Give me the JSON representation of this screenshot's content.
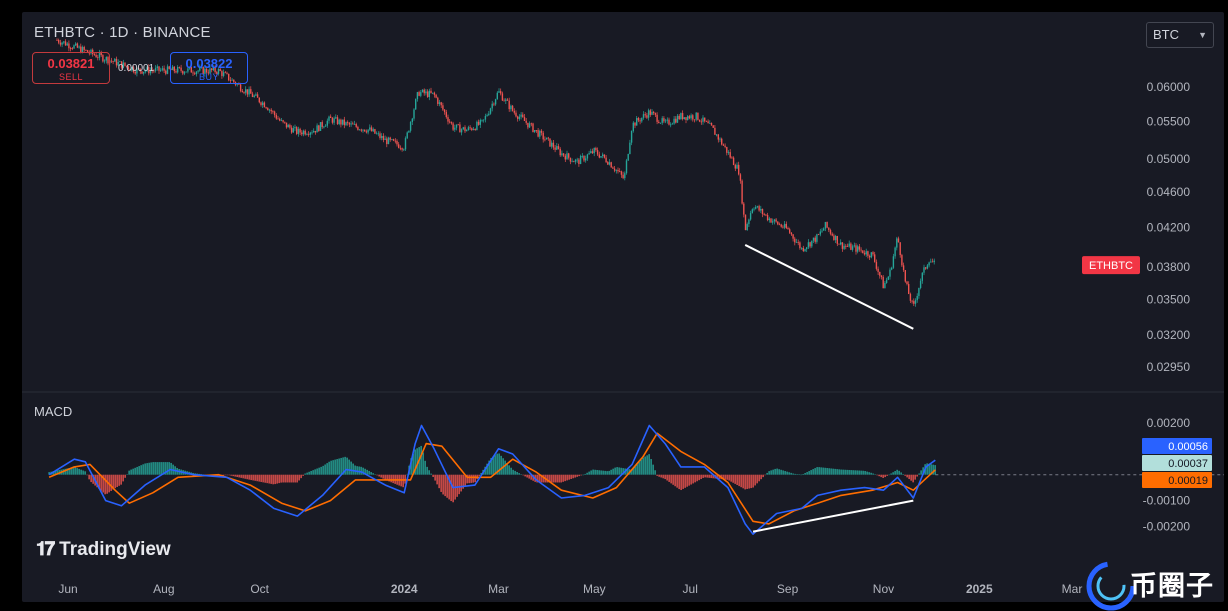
{
  "header": {
    "symbol_line": "ETHBTC · 1D · BINANCE"
  },
  "trade": {
    "sell_price": "0.03821",
    "sell_label": "SELL",
    "spread": "0.00001",
    "buy_price": "0.03822",
    "buy_label": "BUY"
  },
  "currency_select": {
    "value": "BTC"
  },
  "macd": {
    "title": "MACD"
  },
  "branding": {
    "logo_text": "TradingView",
    "watermark_text": "币圈子"
  },
  "colors": {
    "up": "#26a69a",
    "down": "#ef5350",
    "macd_line": "#2962ff",
    "signal_line": "#ff6d00",
    "hist_up": "#26a69a",
    "hist_down": "#ef5350",
    "badge": "#f23645",
    "annotation": "#ffffff"
  },
  "chart_data": [
    {
      "type": "candlestick",
      "symbol": "ETHBTC",
      "interval": "1D",
      "exchange": "BINANCE",
      "price_axis": {
        "ticks": [
          "0.06000",
          "0.05500",
          "0.05000",
          "0.04600",
          "0.04200",
          "0.03800",
          "0.03500",
          "0.03200",
          "0.02950"
        ],
        "scale": "log",
        "range": [
          0.0283,
          0.064
        ]
      },
      "time_axis": {
        "ticks": [
          "Jun",
          "Aug",
          "Oct",
          "2024",
          "Mar",
          "May",
          "Jul",
          "Sep",
          "Nov",
          "2025",
          "Mar"
        ]
      },
      "last_price_label": "ETHBTC",
      "series": [
        {
          "name": "ETHBTC",
          "approx_close": [
            [
              "2023-05-25",
              0.0676
            ],
            [
              "2023-06-15",
              0.0654
            ],
            [
              "2023-07-15",
              0.0626
            ],
            [
              "2023-08-15",
              0.0626
            ],
            [
              "2023-09-05",
              0.0625
            ],
            [
              "2023-09-20",
              0.0598
            ],
            [
              "2023-10-05",
              0.0573
            ],
            [
              "2023-10-15",
              0.0548
            ],
            [
              "2023-10-25",
              0.0535
            ],
            [
              "2023-11-05",
              0.0538
            ],
            [
              "2023-11-15",
              0.0553
            ],
            [
              "2023-11-25",
              0.0546
            ],
            [
              "2023-12-10",
              0.0538
            ],
            [
              "2023-12-20",
              0.0524
            ],
            [
              "2024-01-01",
              0.0516
            ],
            [
              "2024-01-10",
              0.0592
            ],
            [
              "2024-01-20",
              0.0588
            ],
            [
              "2024-02-01",
              0.0542
            ],
            [
              "2024-02-10",
              0.0538
            ],
            [
              "2024-02-20",
              0.0548
            ],
            [
              "2024-03-01",
              0.0593
            ],
            [
              "2024-03-10",
              0.0565
            ],
            [
              "2024-03-25",
              0.0536
            ],
            [
              "2024-04-10",
              0.0507
            ],
            [
              "2024-04-20",
              0.0496
            ],
            [
              "2024-05-01",
              0.051
            ],
            [
              "2024-05-10",
              0.0497
            ],
            [
              "2024-05-20",
              0.0475
            ],
            [
              "2024-05-25",
              0.0545
            ],
            [
              "2024-06-05",
              0.0563
            ],
            [
              "2024-06-15",
              0.0546
            ],
            [
              "2024-06-25",
              0.0557
            ],
            [
              "2024-07-05",
              0.0557
            ],
            [
              "2024-07-15",
              0.054
            ],
            [
              "2024-07-25",
              0.0508
            ],
            [
              "2024-08-01",
              0.0485
            ],
            [
              "2024-08-05",
              0.0418
            ],
            [
              "2024-08-10",
              0.0445
            ],
            [
              "2024-08-20",
              0.043
            ],
            [
              "2024-09-01",
              0.0418
            ],
            [
              "2024-09-10",
              0.0398
            ],
            [
              "2024-09-20",
              0.041
            ],
            [
              "2024-09-25",
              0.0422
            ],
            [
              "2024-10-05",
              0.0402
            ],
            [
              "2024-10-15",
              0.0398
            ],
            [
              "2024-10-25",
              0.0392
            ],
            [
              "2024-11-01",
              0.0362
            ],
            [
              "2024-11-05",
              0.0374
            ],
            [
              "2024-11-10",
              0.041
            ],
            [
              "2024-11-15",
              0.0365
            ],
            [
              "2024-11-20",
              0.0342
            ],
            [
              "2024-11-25",
              0.037
            ],
            [
              "2024-11-30",
              0.0388
            ],
            [
              "2024-12-04",
              0.0382
            ]
          ]
        }
      ],
      "annotations": [
        {
          "type": "trendline",
          "from": [
            "2024-08-05",
            0.0402
          ],
          "to": [
            "2024-11-20",
            0.0325
          ]
        }
      ]
    },
    {
      "type": "macd",
      "title": "MACD",
      "axis": {
        "ticks": [
          "0.00200",
          "0.00100",
          "-0.00100",
          "-0.00200"
        ],
        "range": [
          -0.0026,
          0.0025
        ]
      },
      "value_labels": [
        "0.00056",
        "0.00037",
        "0.00019"
      ],
      "macd_line": [
        [
          "2023-05-20",
          0.0
        ],
        [
          "2023-06-05",
          0.0006
        ],
        [
          "2023-06-12",
          0.0005
        ],
        [
          "2023-06-25",
          -0.001
        ],
        [
          "2023-07-05",
          -0.0012
        ],
        [
          "2023-07-20",
          -0.0004
        ],
        [
          "2023-08-05",
          0.0002
        ],
        [
          "2023-08-20",
          0.0
        ],
        [
          "2023-09-10",
          -0.0001
        ],
        [
          "2023-09-25",
          -0.0006
        ],
        [
          "2023-10-10",
          -0.0013
        ],
        [
          "2023-10-25",
          -0.0016
        ],
        [
          "2023-11-10",
          -0.0008
        ],
        [
          "2023-11-25",
          0.0002
        ],
        [
          "2023-12-05",
          0.0001
        ],
        [
          "2023-12-20",
          -0.0004
        ],
        [
          "2024-01-01",
          -0.0007
        ],
        [
          "2024-01-08",
          0.0012
        ],
        [
          "2024-01-12",
          0.0019
        ],
        [
          "2024-01-20",
          0.001
        ],
        [
          "2024-02-01",
          -0.0005
        ],
        [
          "2024-02-15",
          -0.0004
        ],
        [
          "2024-03-01",
          0.001
        ],
        [
          "2024-03-10",
          0.0008
        ],
        [
          "2024-03-25",
          -0.0002
        ],
        [
          "2024-04-10",
          -0.0009
        ],
        [
          "2024-04-25",
          -0.0008
        ],
        [
          "2024-05-10",
          -0.0005
        ],
        [
          "2024-05-25",
          0.0004
        ],
        [
          "2024-06-05",
          0.0019
        ],
        [
          "2024-06-15",
          0.0012
        ],
        [
          "2024-06-25",
          0.0003
        ],
        [
          "2024-07-10",
          0.0003
        ],
        [
          "2024-07-25",
          -0.0005
        ],
        [
          "2024-08-05",
          -0.0019
        ],
        [
          "2024-08-10",
          -0.0023
        ],
        [
          "2024-08-25",
          -0.0015
        ],
        [
          "2024-09-10",
          -0.0013
        ],
        [
          "2024-09-20",
          -0.0008
        ],
        [
          "2024-10-05",
          -0.0006
        ],
        [
          "2024-10-20",
          -0.0005
        ],
        [
          "2024-11-01",
          -0.0006
        ],
        [
          "2024-11-10",
          -0.0001
        ],
        [
          "2024-11-20",
          -0.0009
        ],
        [
          "2024-11-28",
          0.0003
        ],
        [
          "2024-12-04",
          0.00056
        ]
      ],
      "signal_line": [
        [
          "2023-05-20",
          -0.0001
        ],
        [
          "2023-06-05",
          0.0003
        ],
        [
          "2023-06-15",
          0.0004
        ],
        [
          "2023-07-01",
          -0.0006
        ],
        [
          "2023-07-10",
          -0.0011
        ],
        [
          "2023-07-25",
          -0.0007
        ],
        [
          "2023-08-10",
          -0.0001
        ],
        [
          "2023-09-05",
          0.0
        ],
        [
          "2023-09-25",
          -0.0004
        ],
        [
          "2023-10-15",
          -0.0011
        ],
        [
          "2023-10-30",
          -0.0014
        ],
        [
          "2023-11-15",
          -0.001
        ],
        [
          "2023-12-01",
          -0.0002
        ],
        [
          "2023-12-20",
          -0.0002
        ],
        [
          "2024-01-05",
          -0.0002
        ],
        [
          "2024-01-15",
          0.0012
        ],
        [
          "2024-01-25",
          0.0011
        ],
        [
          "2024-02-10",
          -0.0001
        ],
        [
          "2024-02-25",
          -0.0001
        ],
        [
          "2024-03-10",
          0.0006
        ],
        [
          "2024-03-25",
          0.0001
        ],
        [
          "2024-04-10",
          -0.0006
        ],
        [
          "2024-04-30",
          -0.0009
        ],
        [
          "2024-05-15",
          -0.0005
        ],
        [
          "2024-06-01",
          0.0007
        ],
        [
          "2024-06-10",
          0.0016
        ],
        [
          "2024-06-25",
          0.0009
        ],
        [
          "2024-07-10",
          0.0004
        ],
        [
          "2024-07-25",
          -0.0003
        ],
        [
          "2024-08-10",
          -0.0018
        ],
        [
          "2024-08-20",
          -0.0019
        ],
        [
          "2024-09-05",
          -0.0014
        ],
        [
          "2024-09-20",
          -0.0011
        ],
        [
          "2024-10-05",
          -0.0008
        ],
        [
          "2024-10-25",
          -0.0006
        ],
        [
          "2024-11-10",
          -0.0003
        ],
        [
          "2024-11-20",
          -0.0006
        ],
        [
          "2024-12-04",
          0.00019
        ]
      ],
      "histogram": {
        "positive_color": "#26a69a",
        "negative_color": "#ef5350",
        "value_at_end": 0.00037
      },
      "annotations": [
        {
          "type": "trendline",
          "from": [
            "2024-08-10",
            -0.0022
          ],
          "to": [
            "2024-11-20",
            -0.001
          ]
        }
      ]
    }
  ]
}
